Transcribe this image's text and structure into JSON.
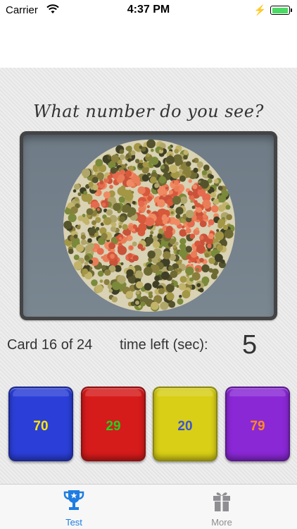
{
  "status_bar": {
    "carrier": "Carrier",
    "time": "4:37 PM",
    "battery_level": 1.0,
    "battery_color": "#4cd964"
  },
  "quiz": {
    "question": "What number do you see?",
    "card_label": "Card 16 of 24",
    "time_label": "time left (sec):",
    "time_value": "5",
    "answers": [
      {
        "label": "70",
        "color": "#2b3fd8",
        "text_color": "#ffe600"
      },
      {
        "label": "29",
        "color": "#d61b1b",
        "text_color": "#22d11f"
      },
      {
        "label": "20",
        "color": "#d8cf16",
        "text_color": "#3a53d9"
      },
      {
        "label": "79",
        "color": "#8a28d6",
        "text_color": "#ff8a1f"
      }
    ]
  },
  "tabs": [
    {
      "label": "Test",
      "icon": "trophy-icon",
      "active": true,
      "color": "#1e7de2"
    },
    {
      "label": "More",
      "icon": "gift-icon",
      "active": false,
      "color": "#8e8e93"
    }
  ]
}
